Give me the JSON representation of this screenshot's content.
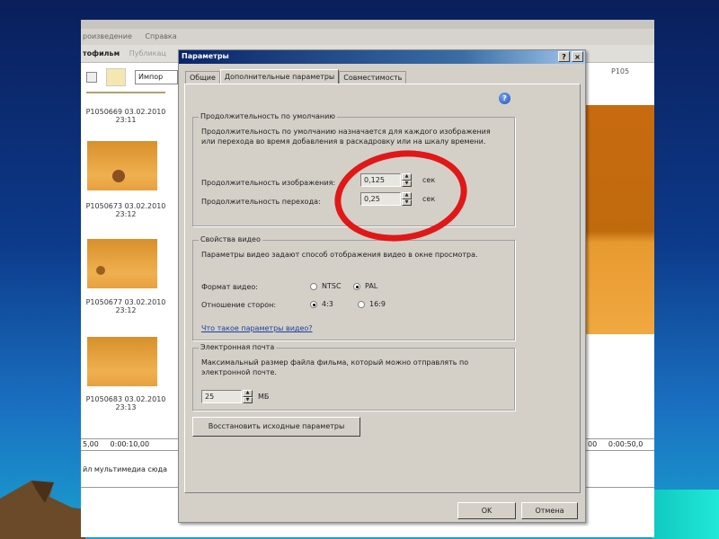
{
  "app": {
    "menu": [
      "роизведение",
      "Справка"
    ],
    "toolbar": [
      "тофильм",
      "Публикац",
      "Импор"
    ],
    "clips": [
      {
        "caption": "P1050669 03.02.2010\n23:11"
      },
      {
        "caption": "P1050673 03.02.2010\n23:12"
      },
      {
        "caption": "P1050677 03.02.2010\n23:12"
      },
      {
        "caption": "P1050683 03.02.2010\n23:13"
      }
    ],
    "preview_label": "P105",
    "ruler_left": "5,00     0:00:10,00",
    "ruler_right": "00     0:00:50,0",
    "track_hint": "йл мультимедиа сюда"
  },
  "dialog": {
    "title": "Параметры",
    "help_btn": "?",
    "close_btn": "×",
    "tabs": [
      "Общие",
      "Дополнительные параметры",
      "Совместимость"
    ],
    "active_tab": 1,
    "help_icon": "?",
    "duration": {
      "legend": "Продолжительность по умолчанию",
      "desc": "Продолжительность по умолчанию назначается для каждого изображения или перехода во время добавления в раскадровку или на шкалу времени.",
      "image_label": "Продолжительность изображения:",
      "image_value": "0,125",
      "transition_label": "Продолжительность перехода:",
      "transition_value": "0,25",
      "unit": "сек"
    },
    "video": {
      "legend": "Свойства видео",
      "desc": "Параметры видео задают способ отображения видео в окне просмотра.",
      "format_label": "Формат видео:",
      "format_options": [
        "NTSC",
        "PAL"
      ],
      "format_selected": "PAL",
      "aspect_label": "Отношение сторон:",
      "aspect_options": [
        "4:3",
        "16:9"
      ],
      "aspect_selected": "4:3",
      "link": "Что такое параметры видео?"
    },
    "email": {
      "legend": "Электронная почта",
      "desc": "Максимальный размер файла фильма, который можно отправлять по электронной почте.",
      "value": "25",
      "unit": "МБ"
    },
    "restore_button": "Восстановить исходные параметры",
    "ok_button": "OK",
    "cancel_button": "Отмена"
  },
  "colors": {
    "highlight": "#e01818",
    "title_bar": "#0a246a"
  }
}
